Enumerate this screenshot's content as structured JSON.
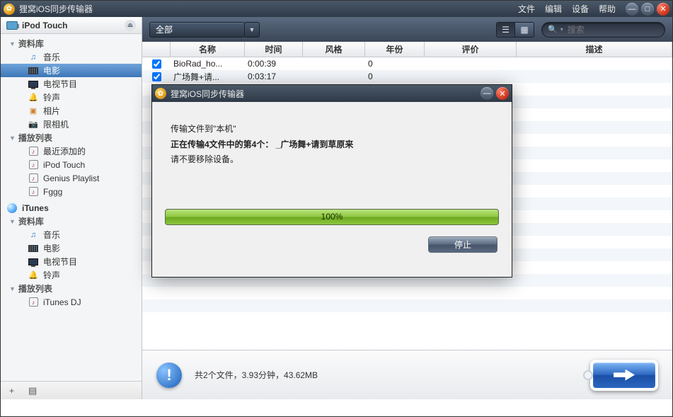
{
  "app": {
    "title": "狸窝iOS同步传输器",
    "menus": [
      "文件",
      "编辑",
      "设备",
      "帮助"
    ]
  },
  "sidebar": {
    "device": "iPod Touch",
    "sections": [
      {
        "label": "资料库",
        "items": [
          {
            "label": "音乐",
            "icon": "music"
          },
          {
            "label": "电影",
            "icon": "movie",
            "selected": true
          },
          {
            "label": "电视节目",
            "icon": "tv"
          },
          {
            "label": "铃声",
            "icon": "bell"
          },
          {
            "label": "相片",
            "icon": "photo"
          },
          {
            "label": "限相机",
            "icon": "cam"
          }
        ]
      },
      {
        "label": "播放列表",
        "items": [
          {
            "label": "最近添加的",
            "icon": "pl"
          },
          {
            "label": "iPod Touch",
            "icon": "pl"
          },
          {
            "label": "Genius Playlist",
            "icon": "pl"
          },
          {
            "label": "Fggg",
            "icon": "pl"
          }
        ]
      }
    ],
    "itunes": {
      "label": "iTunes",
      "sections": [
        {
          "label": "资料库",
          "items": [
            {
              "label": "音乐",
              "icon": "music"
            },
            {
              "label": "电影",
              "icon": "movie"
            },
            {
              "label": "电视节目",
              "icon": "tv"
            },
            {
              "label": "铃声",
              "icon": "bell"
            }
          ]
        },
        {
          "label": "播放列表",
          "items": [
            {
              "label": "iTunes DJ",
              "icon": "pl"
            }
          ]
        }
      ]
    }
  },
  "toolbar": {
    "filter": "全部",
    "search_placeholder": "搜索"
  },
  "columns": {
    "name": "名称",
    "time": "时间",
    "style": "风格",
    "year": "年份",
    "rate": "评价",
    "desc": "描述"
  },
  "rows": [
    {
      "checked": true,
      "name": "BioRad_ho...",
      "time": "0:00:39",
      "style": "",
      "year": "0",
      "rate": "",
      "desc": ""
    },
    {
      "checked": true,
      "name": "广场舞+请...",
      "time": "0:03:17",
      "style": "",
      "year": "0",
      "rate": "",
      "desc": ""
    }
  ],
  "footer": {
    "summary": "共2个文件，3.93分钟，43.62MB"
  },
  "modal": {
    "title": "狸窝iOS同步传输器",
    "line1": "传输文件到\"本机\"",
    "line2": "正在传输4文件中的第4个： _广场舞+请到草原来",
    "line3": "请不要移除设备。",
    "progress_pct": "100%",
    "stop": "停止"
  }
}
